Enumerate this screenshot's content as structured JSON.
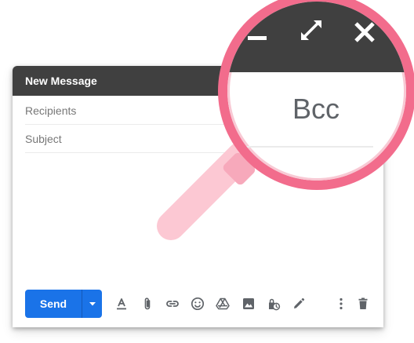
{
  "compose": {
    "title": "New Message",
    "recipients_placeholder": "Recipients",
    "subject_placeholder": "Subject",
    "send_label": "Send",
    "send_options_icon": "caret-down-icon",
    "toolbar_icons": [
      "format-text-icon",
      "attach-file-icon",
      "insert-link-icon",
      "insert-emoji-icon",
      "insert-drive-icon",
      "insert-photo-icon",
      "confidential-mode-icon",
      "insert-signature-icon",
      "more-options-icon",
      "discard-draft-icon"
    ]
  },
  "magnifier": {
    "zoomed_label": "Bcc",
    "zoomed_icons": [
      "minimize-icon",
      "full-screen-icon",
      "close-icon"
    ]
  },
  "colors": {
    "title_bar": "#404040",
    "send_button": "#1a73e8",
    "magnifier_ring": "#f26c8c",
    "magnifier_handle": "#fcc8d3",
    "icon_gray": "#5f6368",
    "placeholder_text": "#777777"
  }
}
